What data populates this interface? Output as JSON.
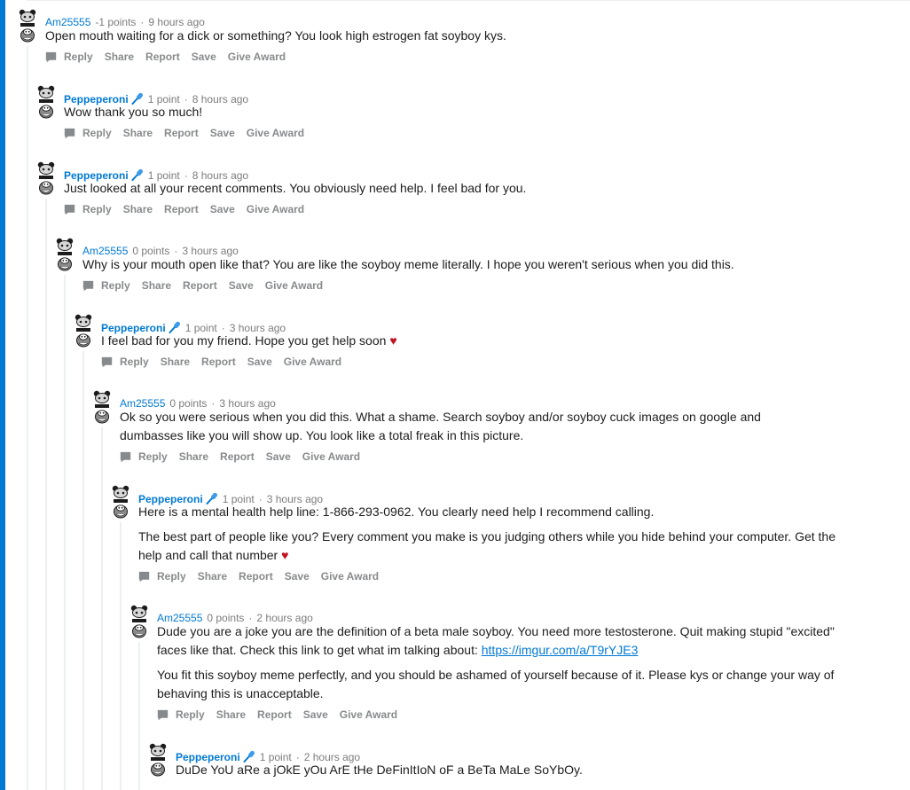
{
  "comments": [
    {
      "author": "Am25555",
      "points": "-1 points",
      "time": "9 hours ago",
      "paragraphs": [
        "Open mouth waiting for a dick or something? You look high estrogen fat soyboy kys."
      ]
    },
    {
      "author": "Peppeperoni",
      "points": "1 point",
      "time": "8 hours ago",
      "paragraphs": [
        "Wow thank you so much!"
      ]
    },
    {
      "author": "Peppeperoni",
      "points": "1 point",
      "time": "8 hours ago",
      "paragraphs": [
        "Just looked at all your recent comments. You obviously need help. I feel bad for you."
      ]
    },
    {
      "author": "Am25555",
      "points": "0 points",
      "time": "3 hours ago",
      "paragraphs": [
        "Why is your mouth open like that? You are like the soyboy meme literally. I hope you weren't serious when you did this."
      ]
    },
    {
      "author": "Peppeperoni",
      "points": "1 point",
      "time": "3 hours ago",
      "paragraphs": [
        "I feel bad for you my friend. Hope you get help soon"
      ]
    },
    {
      "author": "Am25555",
      "points": "0 points",
      "time": "3 hours ago",
      "paragraphs": [
        "Ok so you were serious when you did this. What a shame. Search soyboy and/or soyboy cuck images on google and dumbasses like you will show up. You look like a total freak in this picture."
      ]
    },
    {
      "author": "Peppeperoni",
      "points": "1 point",
      "time": "3 hours ago",
      "paragraphs": [
        "Here is a mental health help line: 1-866-293-0962. You clearly need help I recommend calling.",
        "The best part of people like you? Every comment you make is you judging others while you hide behind your computer. Get the help and call that number"
      ]
    },
    {
      "author": "Am25555",
      "points": "0 points",
      "time": "2 hours ago",
      "paragraphs": [
        "Dude you are a joke you are the definition of a beta male soyboy. You need more testosterone. Quit making stupid \"excited\" faces like that. Check this link to get what im talking about:",
        "You fit this soyboy meme perfectly, and you should be ashamed of yourself because of it. Please kys or change your way of behaving this is unacceptable."
      ],
      "link": "https://imgur.com/a/T9rYJE3"
    },
    {
      "author": "Peppeperoni",
      "points": "1 point",
      "time": "2 hours ago",
      "paragraphs": [
        "DuDe YoU aRe a jOkE yOu ArE tHe DeFinItIoN oF a BeTa MaLe SoYbOy."
      ]
    }
  ],
  "actions": {
    "reply": "Reply",
    "share": "Share",
    "report": "Report",
    "save": "Save",
    "award": "Give Award"
  },
  "icons": {
    "mic": "microphone-icon",
    "comment": "comment-bubble-icon",
    "avatar": "snoo-avatar-icon"
  },
  "colors": {
    "accent": "#0079d3",
    "meta": "#7c7c7c",
    "action": "#878a8c",
    "thread": "#edeff1",
    "heart": "#c1121f"
  }
}
